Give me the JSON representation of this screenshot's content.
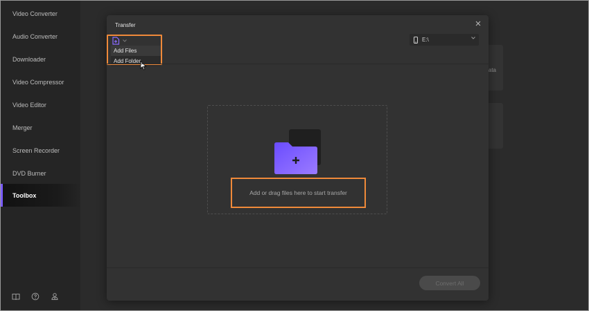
{
  "sidebar": {
    "items": [
      {
        "label": "Video Converter",
        "active": false
      },
      {
        "label": "Audio Converter",
        "active": false
      },
      {
        "label": "Downloader",
        "active": false
      },
      {
        "label": "Video Compressor",
        "active": false
      },
      {
        "label": "Video Editor",
        "active": false
      },
      {
        "label": "Merger",
        "active": false
      },
      {
        "label": "Screen Recorder",
        "active": false
      },
      {
        "label": "DVD Burner",
        "active": false
      },
      {
        "label": "Toolbox",
        "active": true
      }
    ],
    "bottom_icons": [
      "book-icon",
      "help-icon",
      "account-icon"
    ]
  },
  "background": {
    "card_text": "ata"
  },
  "modal": {
    "title": "Transfer",
    "add_menu": {
      "items": [
        "Add Files",
        "Add Folder"
      ],
      "hovered": "Add Folder"
    },
    "device": {
      "label": "E:\\",
      "icon": "phone-icon"
    },
    "drop_zone": {
      "text": "Add or drag files here to start transfer"
    },
    "footer": {
      "button_label": "Convert All"
    }
  },
  "colors": {
    "accent": "#7b5cff",
    "highlight": "#f08a3a",
    "folder_gradient_start": "#6a4cff",
    "folder_gradient_end": "#9b7bff"
  }
}
